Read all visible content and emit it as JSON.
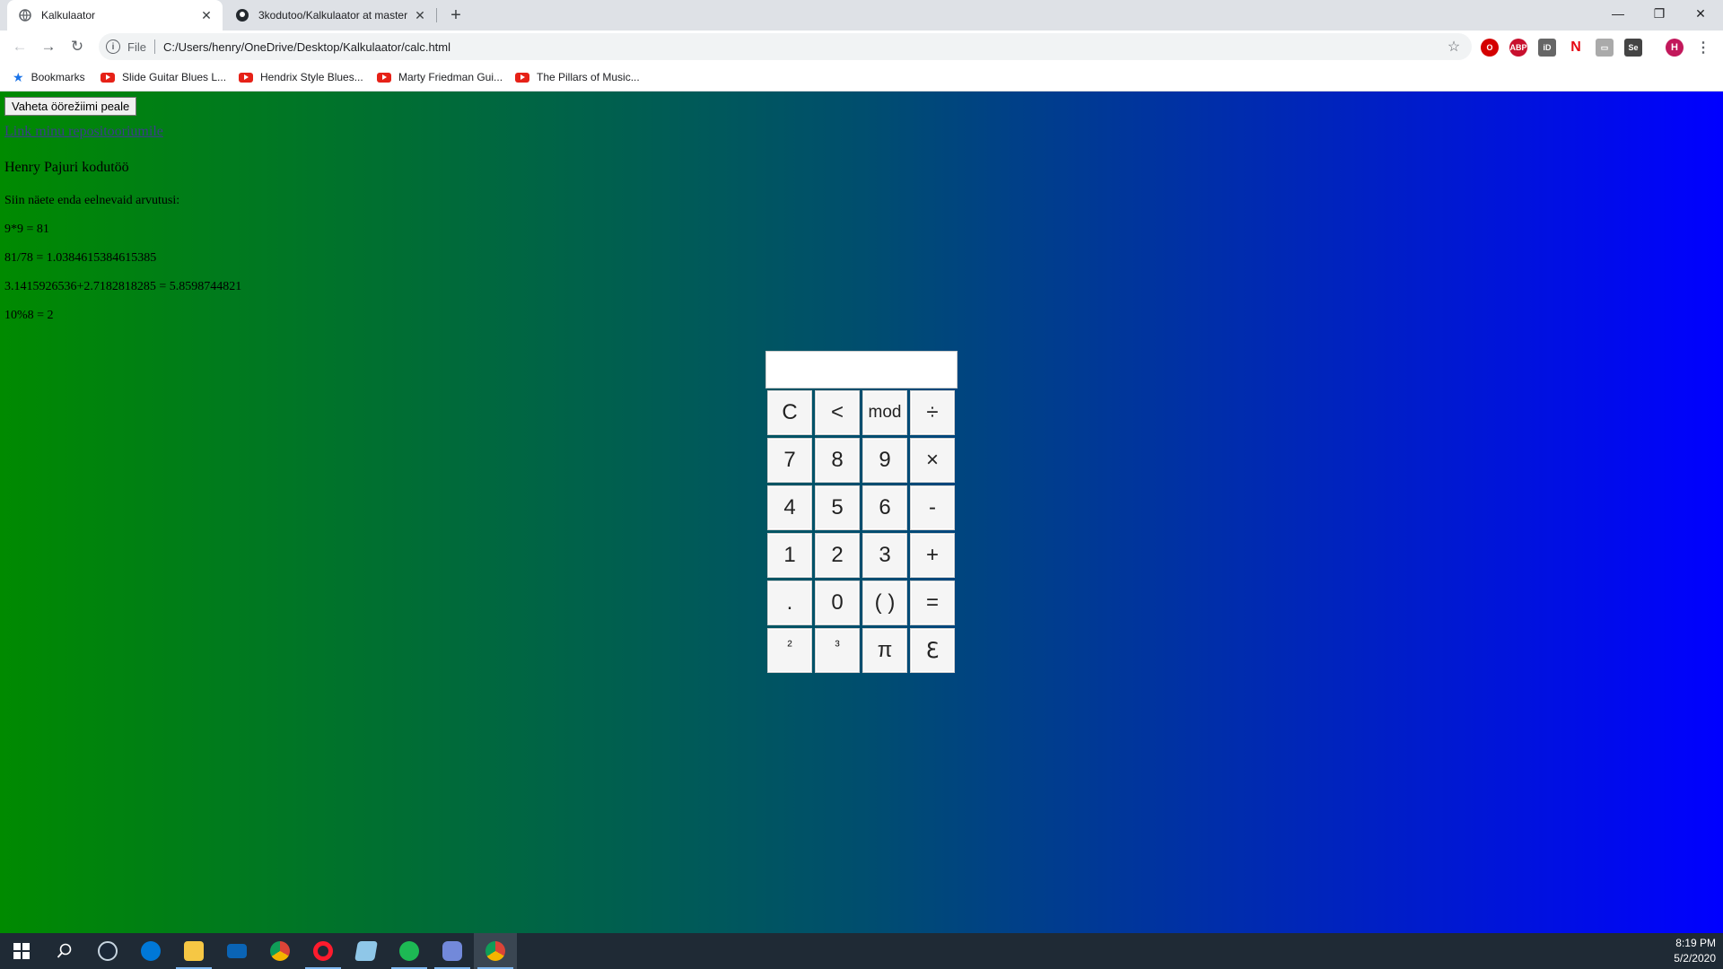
{
  "browser": {
    "tabs": [
      {
        "title": "Kalkulaator",
        "active": true
      },
      {
        "title": "3kodutoo/Kalkulaator at master",
        "active": false
      }
    ],
    "new_tab_symbol": "+",
    "url_scheme": "File",
    "url": "C:/Users/henry/OneDrive/Desktop/Kalkulaator/calc.html",
    "profile_initial": "H",
    "bookmarks": [
      {
        "label": "Bookmarks",
        "icon": "star-icon"
      },
      {
        "label": "Slide Guitar Blues L...",
        "icon": "youtube-icon"
      },
      {
        "label": "Hendrix Style Blues...",
        "icon": "youtube-icon"
      },
      {
        "label": "Marty Friedman Gui...",
        "icon": "youtube-icon"
      },
      {
        "label": "The Pillars of Music...",
        "icon": "youtube-icon"
      }
    ]
  },
  "page": {
    "mode_button": "Vaheta öörežiimi peale",
    "repo_link": "Link minu repositooriumile",
    "author": "Henry Pajuri kodutöö",
    "history_title": "Siin näete enda eelnevaid arvutusi:",
    "history": [
      "9*9 = 81",
      "81/78 = 1.0384615384615385",
      "3.1415926536+2.7182818285 = 5.8598744821",
      "10%8 = 2"
    ],
    "gradient": {
      "start": "#008a00",
      "mid": "#004e6e",
      "end": "#0000ff"
    }
  },
  "calculator": {
    "display_value": "",
    "keys": [
      [
        "C",
        "<",
        "mod",
        "÷"
      ],
      [
        "7",
        "8",
        "9",
        "×"
      ],
      [
        "4",
        "5",
        "6",
        "-"
      ],
      [
        "1",
        "2",
        "3",
        "+"
      ],
      [
        ".",
        "0",
        "( )",
        "="
      ],
      [
        "²",
        "³",
        "π",
        "ℇ"
      ]
    ]
  },
  "taskbar": {
    "time": "8:19 PM",
    "date": "5/2/2020"
  }
}
